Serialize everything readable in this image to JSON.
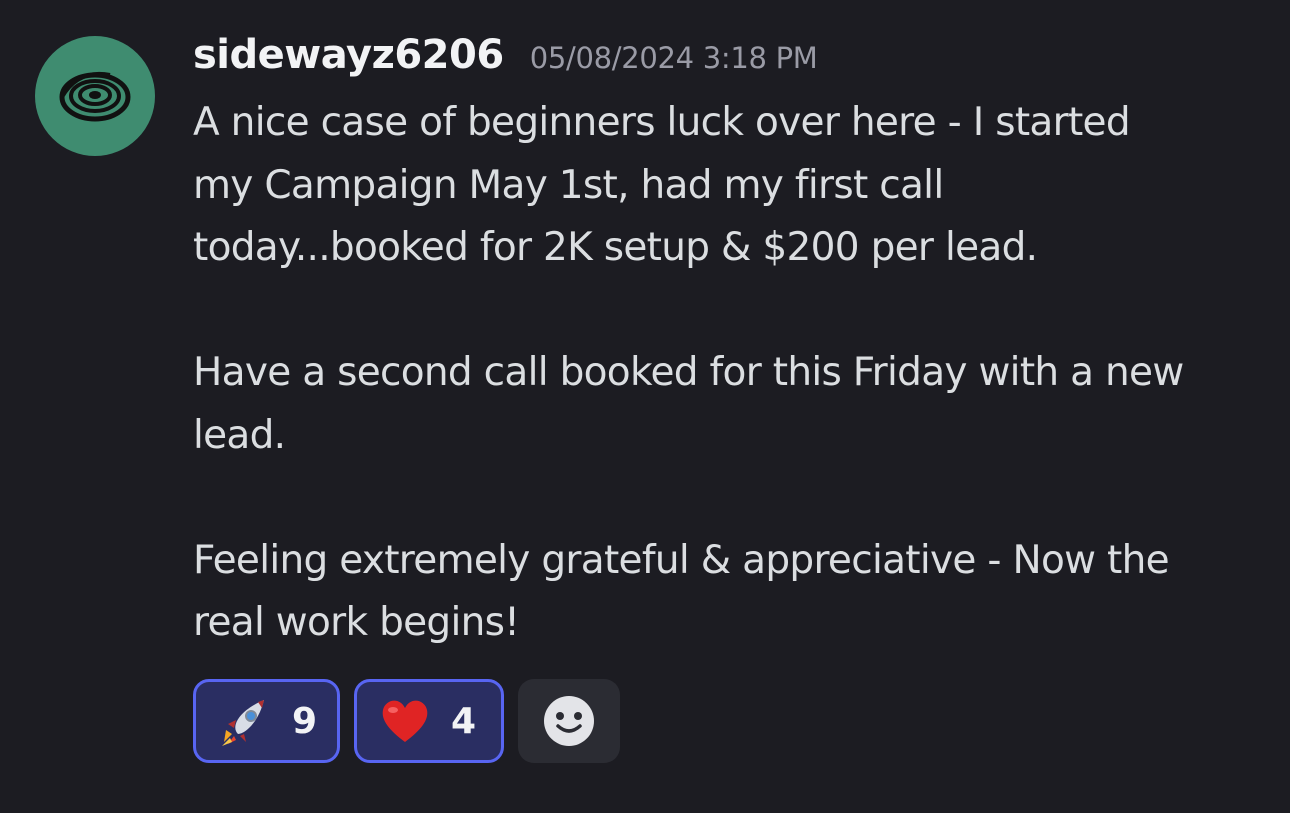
{
  "message": {
    "avatar": {
      "icon": "spiral-eye-icon",
      "color": "#3f8c70"
    },
    "username": "sidewayz6206",
    "timestamp": "05/08/2024 3:18 PM",
    "paragraphs": [
      "A nice case of beginners luck over here - I started\nmy Campaign May 1st, had my first call\ntoday...booked for 2K setup & $200 per lead.",
      "Have a second call booked for this Friday with a new\nlead.",
      "Feeling extremely grateful & appreciative - Now the\nreal work begins!"
    ],
    "reactions": [
      {
        "emoji": "rocket-emoji",
        "count": "9"
      },
      {
        "emoji": "red-heart-emoji",
        "count": "4"
      }
    ],
    "add_reaction_icon": "smiley-face-icon"
  },
  "colors": {
    "background": "#1c1c22",
    "reaction_border": "#5865f2",
    "reaction_bg": "#2a2e62"
  }
}
